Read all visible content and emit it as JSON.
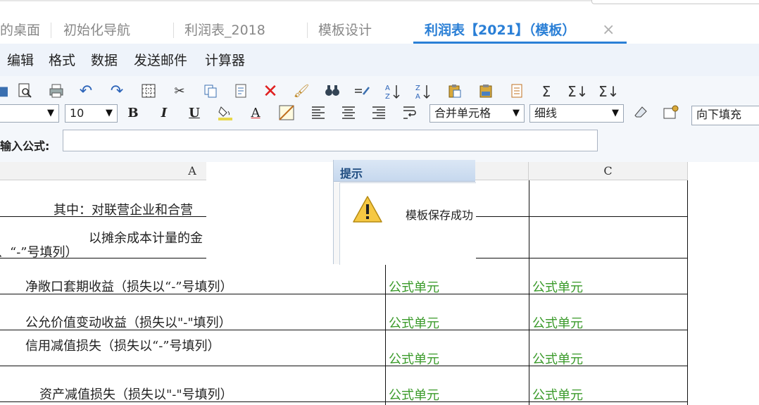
{
  "tabs": [
    {
      "label": "的桌面",
      "active": false
    },
    {
      "label": "初始化导航",
      "active": false
    },
    {
      "label": "利润表_2018",
      "active": false
    },
    {
      "label": "模板设计",
      "active": false
    },
    {
      "label": "利润表【2021】（模板）",
      "active": true
    }
  ],
  "tab_close": "×",
  "menu": [
    "编辑",
    "格式",
    "数据",
    "发送邮件",
    "计算器"
  ],
  "toolbar": {
    "icons": [
      "preview-icon",
      "print-icon",
      "undo-icon",
      "redo-icon",
      "grid-icon",
      "cut-icon",
      "copy-icon",
      "paste-special-icon",
      "delete-icon",
      "format-brush-icon",
      "find-icon",
      "replace-icon",
      "sort-asc-icon",
      "sort-desc-icon",
      "paste-icon",
      "paste-value-icon",
      "clipboard-icon",
      "sum-icon",
      "sum-row-icon",
      "sum-col-icon"
    ],
    "font_size": "10",
    "bold": "B",
    "italic": "I",
    "underline": "U",
    "font_color_glyph": "A",
    "merge_select": "合并单元格",
    "border_select": "细线",
    "fill_select": "向下填充",
    "formula_label": "输入公式:",
    "formula_value": ""
  },
  "grid": {
    "columns": [
      "A",
      "C"
    ],
    "rows": [
      {
        "a": "其中：对联营企业和合营",
        "b": "",
        "c": ""
      },
      {
        "a": "以摊余成本计量的金",
        "a2": "、“-”号填列）",
        "b": "",
        "c": ""
      },
      {
        "a": "净敞口套期收益（损失以“-”号填列）",
        "b": "公式单元",
        "c": "公式单元"
      },
      {
        "a": "公允价值变动收益（损失以\"-\"填列）",
        "b": "公式单元",
        "c": "公式单元"
      },
      {
        "a": "信用减值损失（损失以“-”号填列）",
        "b": "公式单元",
        "c": "公式单元"
      },
      {
        "a": "资产减值损失（损失以\"-\"号填列）",
        "b": "公式单元",
        "c": "公式单元"
      }
    ]
  },
  "dialog": {
    "title": "提示",
    "message": "模板保存成功",
    "icon": "warning-icon"
  },
  "colors": {
    "accent": "#2a7fd6",
    "formula_green": "#3a9a2a",
    "menu_bg": "#eef3fa"
  }
}
